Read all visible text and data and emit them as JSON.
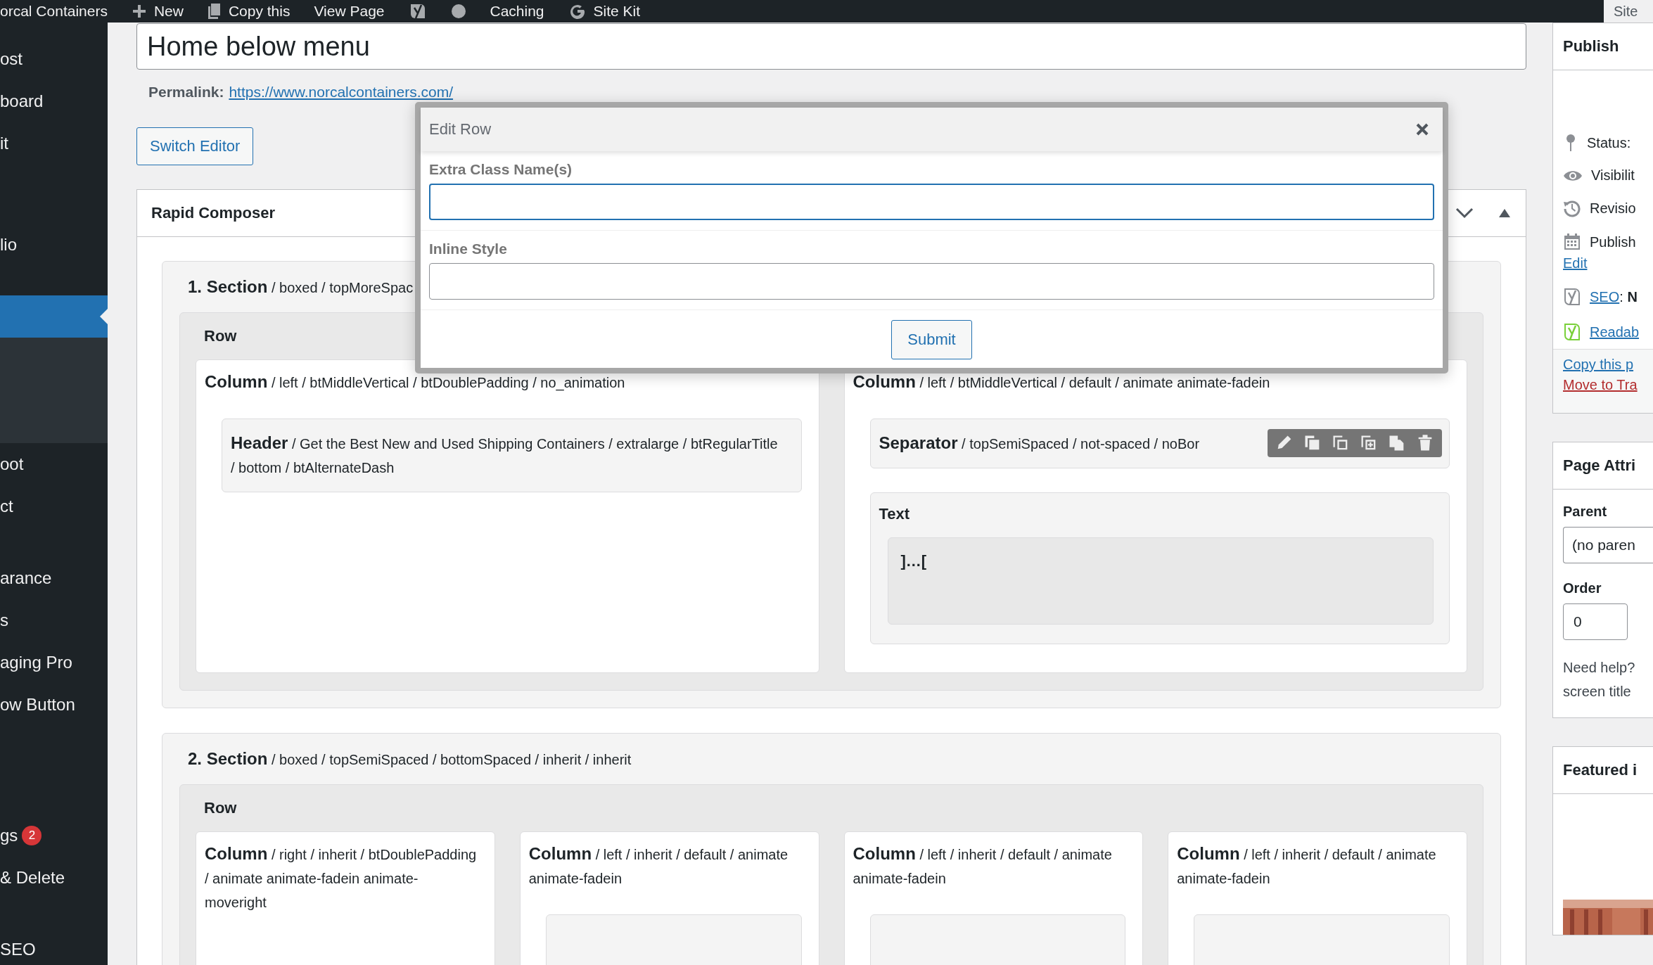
{
  "admin_bar": {
    "items": [
      {
        "kind": "text",
        "label": "orcal Containers"
      },
      {
        "kind": "new",
        "label": "New"
      },
      {
        "kind": "copy",
        "label": "Copy this"
      },
      {
        "kind": "text",
        "label": "View Page"
      },
      {
        "kind": "seo"
      },
      {
        "kind": "dot"
      },
      {
        "kind": "text",
        "label": "Caching"
      },
      {
        "kind": "sitekit",
        "label": "Site Kit"
      }
    ],
    "screen_tab": "Site"
  },
  "sidebar": {
    "items": [
      {
        "kind": "item",
        "label": "ost",
        "selected": false
      },
      {
        "kind": "item",
        "label": "board",
        "selected": false
      },
      {
        "kind": "item",
        "label": "it",
        "selected": false
      },
      {
        "kind": "separator"
      },
      {
        "kind": "separator"
      },
      {
        "kind": "item",
        "label": "lio",
        "selected": false
      },
      {
        "kind": "separator"
      },
      {
        "kind": "item",
        "selected": true
      },
      {
        "kind": "submenu"
      },
      {
        "kind": "item",
        "label": "oot",
        "selected": false
      },
      {
        "kind": "item",
        "label": "ct",
        "selected": false
      },
      {
        "kind": "separator"
      },
      {
        "kind": "item",
        "label": "arance",
        "selected": false
      },
      {
        "kind": "item",
        "label": "s",
        "selected": false
      },
      {
        "kind": "item",
        "label": "aging Pro",
        "selected": false
      },
      {
        "kind": "item",
        "label": "ow Button",
        "selected": false
      },
      {
        "kind": "separator"
      },
      {
        "kind": "separator"
      },
      {
        "kind": "separator"
      },
      {
        "kind": "item",
        "label": "gs",
        "badge": "2",
        "selected": false
      },
      {
        "kind": "item",
        "label": "& Delete",
        "selected": false
      },
      {
        "kind": "separator"
      },
      {
        "kind": "item",
        "label": "SEO",
        "selected": false
      }
    ]
  },
  "editor": {
    "title": "Home below menu",
    "permalink_label": "Permalink:",
    "permalink_url": "https://www.norcalcontainers.com/",
    "switch_editor": "Switch Editor"
  },
  "composer": {
    "title": "Rapid Composer",
    "sections": [
      {
        "title": "**1. Section** / boxed / topMoreSpac",
        "rows": [
          {
            "title": "Row",
            "columns": [
              {
                "title": "**Column** / left / btMiddleVertical / btDoublePadding / no_animation",
                "blocks": [
                  {
                    "kind": "element",
                    "title": "**Header** / Get the Best New and Used Shipping Containers / extralarge / btRegularTitle / bottom / btAlternateDash"
                  }
                ]
              },
              {
                "title": "**Column** / left / btMiddleVertical / default / animate animate-fadein",
                "blocks": [
                  {
                    "kind": "element",
                    "title": "**Separator** / topSemiSpaced / not-spaced / noBor",
                    "toolbar": true
                  },
                  {
                    "kind": "text",
                    "title": "Text",
                    "content": "]…["
                  }
                ]
              }
            ]
          }
        ]
      },
      {
        "title": "**2. Section** / boxed / topSemiSpaced / bottomSpaced / inherit / inherit",
        "rows": [
          {
            "title": "Row",
            "columns": [
              {
                "title": "**Column** / right / inherit / btDoublePadding / animate animate-fadein animate-moveright"
              },
              {
                "title": "**Column** / left / inherit / default / animate animate-fadein",
                "blocks": [
                  {
                    "kind": "stub"
                  }
                ]
              },
              {
                "title": "**Column** / left / inherit / default / animate animate-fadein",
                "blocks": [
                  {
                    "kind": "stub"
                  }
                ]
              },
              {
                "title": "**Column** / left / inherit / default / animate animate-fadein",
                "blocks": [
                  {
                    "kind": "stub"
                  }
                ]
              }
            ]
          }
        ]
      }
    ]
  },
  "modal": {
    "title": "Edit Row",
    "fields": [
      {
        "label": "Extra Class Name(s)",
        "focused": true
      },
      {
        "label": "Inline Style",
        "focused": false
      }
    ],
    "submit": "Submit"
  },
  "publish_box": {
    "title": "Publish",
    "rows": [
      {
        "kind": "status",
        "label": "Status:"
      },
      {
        "kind": "visibility",
        "label": "Visibilit"
      },
      {
        "kind": "revisions",
        "label": "Revisio"
      },
      {
        "kind": "schedule",
        "label": "Publish",
        "link": "Edit"
      },
      {
        "kind": "seo",
        "link": "SEO",
        "value": ": **N**"
      },
      {
        "kind": "readability",
        "link": "Readab"
      }
    ],
    "copy_link": "Copy this p",
    "trash_link": "Move to Tra"
  },
  "page_attributes": {
    "title": "Page Attri",
    "parent_label": "Parent",
    "parent_value": "(no paren",
    "order_label": "Order",
    "order_value": "0",
    "help": [
      "Need help?",
      "screen title"
    ]
  },
  "featured_image": {
    "title": "Featured i"
  }
}
